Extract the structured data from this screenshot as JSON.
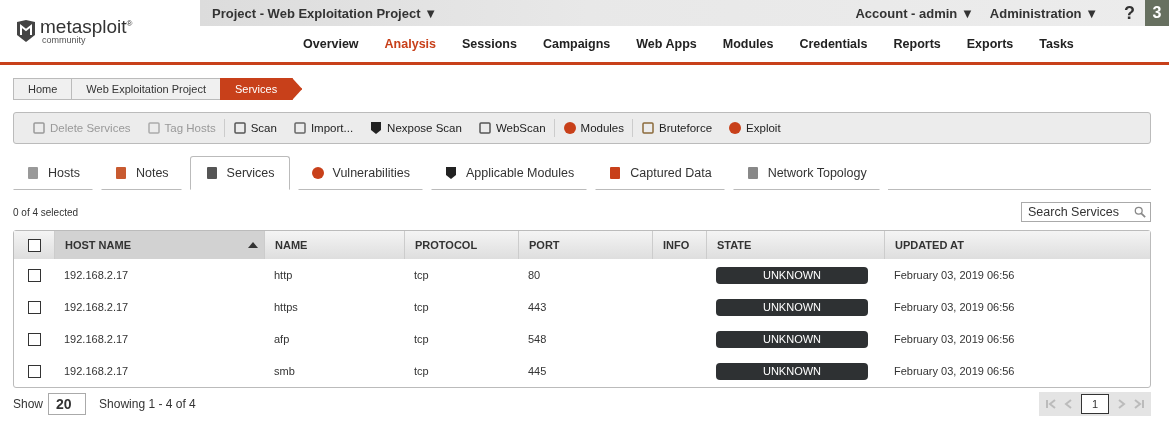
{
  "logo": {
    "name": "metasploit",
    "mark": "®",
    "edition": "community"
  },
  "project_menu": {
    "label": "Project - Web Exploitation Project ▼"
  },
  "account_menu": {
    "label": "Account - admin ▼"
  },
  "admin_menu": {
    "label": "Administration ▼"
  },
  "help": {
    "label": "?"
  },
  "badge": {
    "label": "3"
  },
  "nav": [
    {
      "label": "Overview",
      "selected": false
    },
    {
      "label": "Analysis",
      "selected": true
    },
    {
      "label": "Sessions",
      "selected": false
    },
    {
      "label": "Campaigns",
      "selected": false
    },
    {
      "label": "Web Apps",
      "selected": false
    },
    {
      "label": "Modules",
      "selected": false
    },
    {
      "label": "Credentials",
      "selected": false
    },
    {
      "label": "Reports",
      "selected": false
    },
    {
      "label": "Exports",
      "selected": false
    },
    {
      "label": "Tasks",
      "selected": false
    }
  ],
  "breadcrumbs": [
    {
      "label": "Home",
      "selected": false
    },
    {
      "label": "Web Exploitation Project",
      "selected": false
    },
    {
      "label": "Services",
      "selected": true
    }
  ],
  "toolbar": [
    {
      "label": "Delete Services",
      "kind": "trash",
      "disabled": true,
      "separator": false
    },
    {
      "label": "Tag Hosts",
      "kind": "tag",
      "disabled": true,
      "separator": true
    },
    {
      "label": "Scan",
      "kind": "scan",
      "disabled": false,
      "separator": false
    },
    {
      "label": "Import...",
      "kind": "import",
      "disabled": false,
      "separator": false
    },
    {
      "label": "Nexpose Scan",
      "kind": "shield",
      "disabled": false,
      "separator": false
    },
    {
      "label": "WebScan",
      "kind": "scan",
      "disabled": false,
      "separator": true
    },
    {
      "label": "Modules",
      "kind": "bug",
      "disabled": false,
      "separator": true
    },
    {
      "label": "Bruteforce",
      "kind": "brute",
      "disabled": false,
      "separator": false
    },
    {
      "label": "Exploit",
      "kind": "bug",
      "disabled": false,
      "separator": false
    }
  ],
  "tabs": [
    {
      "label": "Hosts",
      "kind": "host",
      "selected": false
    },
    {
      "label": "Notes",
      "kind": "note",
      "selected": false
    },
    {
      "label": "Services",
      "kind": "scan",
      "selected": true
    },
    {
      "label": "Vulnerabilities",
      "kind": "bug",
      "selected": false
    },
    {
      "label": "Applicable Modules",
      "kind": "shield",
      "selected": false
    },
    {
      "label": "Captured Data",
      "kind": "data",
      "selected": false
    },
    {
      "label": "Network Topology",
      "kind": "topology",
      "selected": false
    }
  ],
  "selection_count": "0 of 4 selected",
  "search": {
    "placeholder": "Search Services"
  },
  "table": {
    "select_all": {
      "checked": false
    },
    "columns": [
      {
        "label": "HOST NAME",
        "sorted": true
      },
      {
        "label": "NAME",
        "sorted": false
      },
      {
        "label": "PROTOCOL",
        "sorted": false
      },
      {
        "label": "PORT",
        "sorted": false
      },
      {
        "label": "INFO",
        "sorted": false
      },
      {
        "label": "STATE",
        "sorted": false
      },
      {
        "label": "UPDATED AT",
        "sorted": false
      }
    ],
    "rows": [
      {
        "checked": false,
        "host": "192.168.2.17",
        "name": "http",
        "protocol": "tcp",
        "port": "80",
        "state": "UNKNOWN",
        "updated": "February 03, 2019 06:56"
      },
      {
        "checked": false,
        "host": "192.168.2.17",
        "name": "https",
        "protocol": "tcp",
        "port": "443",
        "state": "UNKNOWN",
        "updated": "February 03, 2019 06:56"
      },
      {
        "checked": false,
        "host": "192.168.2.17",
        "name": "afp",
        "protocol": "tcp",
        "port": "548",
        "state": "UNKNOWN",
        "updated": "February 03, 2019 06:56"
      },
      {
        "checked": false,
        "host": "192.168.2.17",
        "name": "smb",
        "protocol": "tcp",
        "port": "445",
        "state": "UNKNOWN",
        "updated": "February 03, 2019 06:56"
      }
    ]
  },
  "footer": {
    "show_label": "Show",
    "per_page": "20",
    "showing": "Showing 1 - 4 of 4"
  },
  "pagination": {
    "page": "1"
  }
}
